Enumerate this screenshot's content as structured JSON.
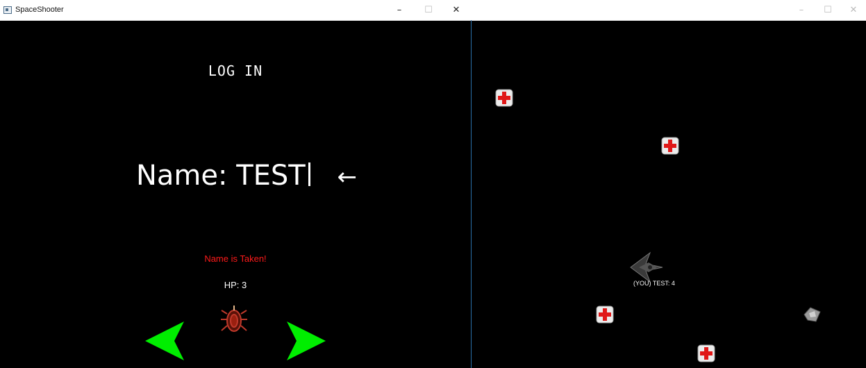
{
  "left_window": {
    "title": "SpaceShooter",
    "controls": {
      "minimize": "–",
      "maximize": "☐",
      "close": "✕"
    }
  },
  "right_window": {
    "title": "",
    "controls": {
      "minimize": "–",
      "maximize": "☐",
      "close": "✕"
    }
  },
  "login_screen": {
    "heading": "LOG IN",
    "name_label": "Name:",
    "name_value": "TEST",
    "name_arrow": "←",
    "error_message": "Name is Taken!",
    "hp_text": "HP: 3",
    "prev_icon": "green-left-arrow-icon",
    "next_icon": "green-right-arrow-icon",
    "ship_icon": "red-ship-icon",
    "colors": {
      "error": "#ff1a1a",
      "arrow": "#00ee00",
      "background": "#000000",
      "text": "#ffffff"
    }
  },
  "game_view": {
    "player_label": "(YOU) TEST: 4",
    "item_icon": "medkit-icon",
    "medkit_count": 4
  }
}
